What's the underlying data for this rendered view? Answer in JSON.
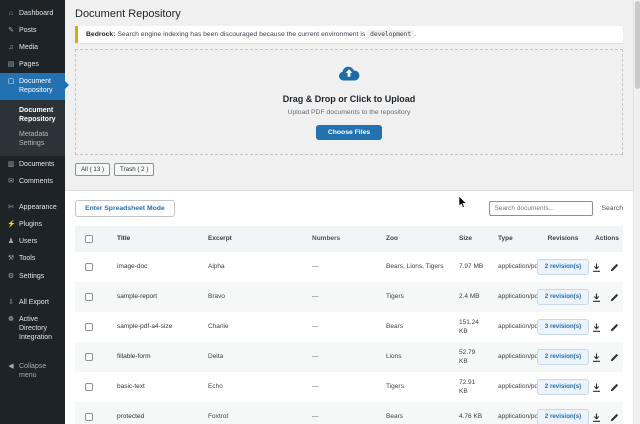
{
  "page": {
    "title": "Document Repository"
  },
  "colors": {
    "accent_blue": "#2271b1",
    "sidebar_bg": "#1d2327",
    "sidebar_active": "#2271b1",
    "notice_accent": "#dba617",
    "page_bg": "#f0f0f1",
    "badge_bg": "#ecf3fa",
    "badge_text": "#2271b1"
  },
  "sidebar": {
    "menu_top": [
      {
        "label": "Dashboard",
        "icon": "dashboard-icon",
        "glyph": "⌂"
      },
      {
        "label": "Posts",
        "icon": "posts-icon",
        "glyph": "✎"
      },
      {
        "label": "Media",
        "icon": "media-icon",
        "glyph": "♫"
      },
      {
        "label": "Pages",
        "icon": "pages-icon",
        "glyph": "▤"
      }
    ],
    "active_item": {
      "label": "Document Repository",
      "glyph": "▢"
    },
    "submenu": [
      {
        "label": "Document Repository"
      },
      {
        "label": "Metadata Settings"
      }
    ],
    "menu_mid": [
      {
        "label": "Documents",
        "icon": "documents-icon",
        "glyph": "▥"
      },
      {
        "label": "Comments",
        "icon": "comments-icon",
        "glyph": "✉"
      }
    ],
    "menu_lower": [
      {
        "label": "Appearance",
        "icon": "appearance-icon",
        "glyph": "✄"
      },
      {
        "label": "Plugins",
        "icon": "plugins-icon",
        "glyph": "⚡"
      },
      {
        "label": "Users",
        "icon": "users-icon",
        "glyph": "♟"
      },
      {
        "label": "Tools",
        "icon": "tools-icon",
        "glyph": "⚒"
      },
      {
        "label": "Settings",
        "icon": "settings-icon",
        "glyph": "⚙"
      }
    ],
    "menu_plugins": [
      {
        "label": "All Export",
        "icon": "all-export-icon",
        "glyph": "⇩"
      },
      {
        "label": "Active Directory Integration",
        "icon": "active-directory-icon",
        "glyph": "☸"
      }
    ],
    "collapse": {
      "label": "Collapse menu",
      "glyph": "◀"
    }
  },
  "notice": {
    "prefix": "Bedrock:",
    "text": " Search engine indexing has been discouraged because the current environment is ",
    "code": "development",
    "suffix": "."
  },
  "upload": {
    "heading": "Drag & Drop or Click to Upload",
    "subtext": "Upload PDF documents to the repository",
    "button_label": "Choose Files"
  },
  "filters": [
    {
      "label": "All ( 13 )"
    },
    {
      "label": "Trash ( 2 )"
    }
  ],
  "toolbar": {
    "spreadsheet_button": "Enter Spreadsheet Mode",
    "search_placeholder": "Search documents...",
    "search_label": "Search"
  },
  "table": {
    "columns": [
      "Title",
      "Excerpt",
      "Numbers",
      "Zoo",
      "Size",
      "Type",
      "Revisions",
      "Actions"
    ],
    "rows": [
      {
        "title": "image-doc",
        "excerpt": "Alpha",
        "numbers": "—",
        "zoo": "Bears, Lions, Tigers",
        "size": "7.97 MB",
        "type": "application/pdf",
        "revisions": "2 revision(s)"
      },
      {
        "title": "sample-report",
        "excerpt": "Bravo",
        "numbers": "—",
        "zoo": "Tigers",
        "size": "2.4 MB",
        "type": "application/pdf",
        "revisions": "2 revision(s)"
      },
      {
        "title": "sample-pdf-a4-size",
        "excerpt": "Charlie",
        "numbers": "—",
        "zoo": "Bears",
        "size": "151.24 KB",
        "type": "application/pdf",
        "revisions": "3 revision(s)"
      },
      {
        "title": "fillable-form",
        "excerpt": "Delta",
        "numbers": "—",
        "zoo": "Lions",
        "size": "52.79 KB",
        "type": "application/pdf",
        "revisions": "2 revision(s)"
      },
      {
        "title": "basic-text",
        "excerpt": "Echo",
        "numbers": "—",
        "zoo": "Tigers",
        "size": "72.91 KB",
        "type": "application/pdf",
        "revisions": "2 revision(s)"
      },
      {
        "title": "protected",
        "excerpt": "Foxtrot",
        "numbers": "—",
        "zoo": "Bears",
        "size": "4.76 KB",
        "type": "application/pdf",
        "revisions": "2 revision(s)"
      }
    ]
  }
}
